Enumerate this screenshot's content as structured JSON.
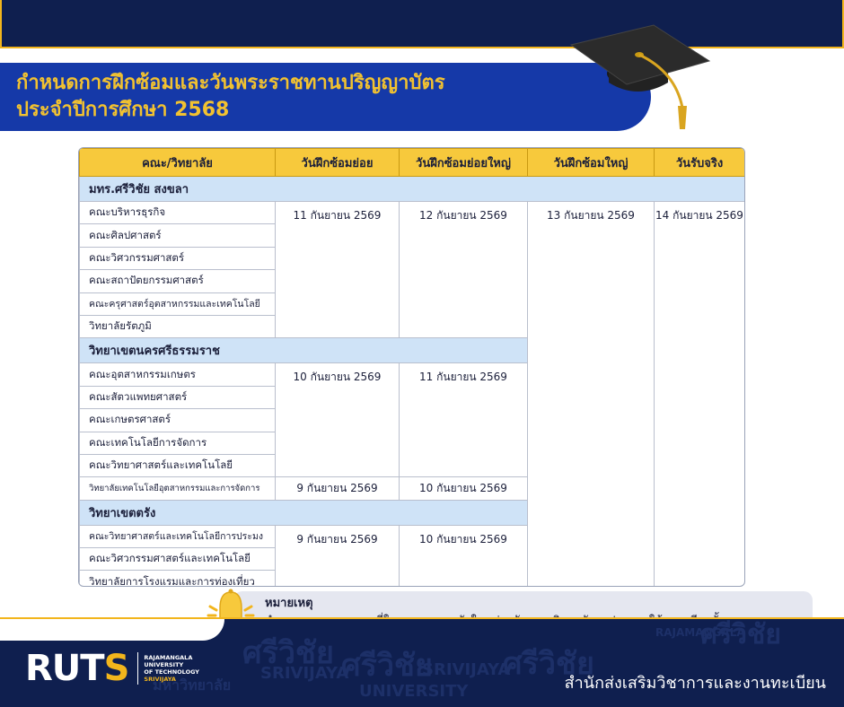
{
  "title": {
    "line1": "กำหนดการฝึกซ้อมและวันพระราชทานปริญญาบัตร",
    "line2": "ประจำปีการศึกษา 2568"
  },
  "table": {
    "headers": [
      "คณะ/วิทยาลัย",
      "วันฝึกซ้อมย่อย",
      "วันฝึกซ้อมย่อยใหญ่",
      "วันฝึกซ้อมใหญ่",
      "วันรับจริง"
    ],
    "campuses": [
      {
        "name": "มทร.ศรีวิชัย สงขลา",
        "faculties": [
          "คณะบริหารธุรกิจ",
          "คณะศิลปศาสตร์",
          "คณะวิศวกรรมศาสตร์",
          "คณะสถาปัตยกรรมศาสตร์",
          "คณะครุศาสตร์อุตสาหกรรมและเทคโนโลยี",
          "วิทยาลัยรัตภูมิ"
        ],
        "sub_rehearsal": "11 กันยายน 2569",
        "major_sub_rehearsal": "12 กันยายน 2569"
      },
      {
        "name": "วิทยาเขตนครศรีธรรมราช",
        "faculties": [
          "คณะอุตสาหกรรมเกษตร",
          "คณะสัตวแพทยศาสตร์",
          "คณะเกษตรศาสตร์",
          "คณะเทคโนโลยีการจัดการ",
          "คณะวิทยาศาสตร์และเทคโนโลยี"
        ],
        "sub_rehearsal": "10 กันยายน 2569",
        "major_sub_rehearsal": "11 กันยายน 2569",
        "extra": {
          "faculty": "วิทยาลัยเทคโนโลยีอุตสาหกรรมและการจัดการ",
          "sub_rehearsal": "9 กันยายน 2569",
          "major_sub_rehearsal": "10 กันยายน 2569"
        }
      },
      {
        "name": "วิทยาเขตตรัง",
        "faculties": [
          "คณะวิทยาศาสตร์และเทคโนโลยีการประมง",
          "คณะวิศวกรรมศาสตร์และเทคโนโลยี",
          "วิทยาลัยการโรงแรมและการท่องเที่ยว"
        ],
        "sub_rehearsal": "9 กันยายน 2569",
        "major_sub_rehearsal": "10 กันยายน 2569"
      }
    ],
    "full_rehearsal": "13 กันยายน 2569",
    "ceremony": "14 กันยายน 2569"
  },
  "note": {
    "title": "หมายเหตุ",
    "text": "กำหนดเวลาและสถานที่ในการรายงานตัวในแต่ละวัน มหาวิทยาลัยจะประกาศให้ทราบอีกครั้ง"
  },
  "footer": {
    "logo": "RUTS",
    "logo_sub": [
      "RAJAMANGALA",
      "UNIVERSITY",
      "OF TECHNOLOGY",
      "SRIVIJAYA"
    ],
    "office": "สำนักส่งเสริมวิชาการและงานทะเบียน",
    "bg_words": [
      "ศรีวิชัย",
      "SRIVIJAYA",
      "UNIVERSITY",
      "มหาวิทยาลัย",
      "RAJAMANGALA"
    ]
  },
  "colors": {
    "navy": "#0f1f4f",
    "banner_blue": "#1539a8",
    "gold": "#f2b51c",
    "header_yellow": "#f7c93c",
    "campus_blue": "#cfe3f7"
  }
}
